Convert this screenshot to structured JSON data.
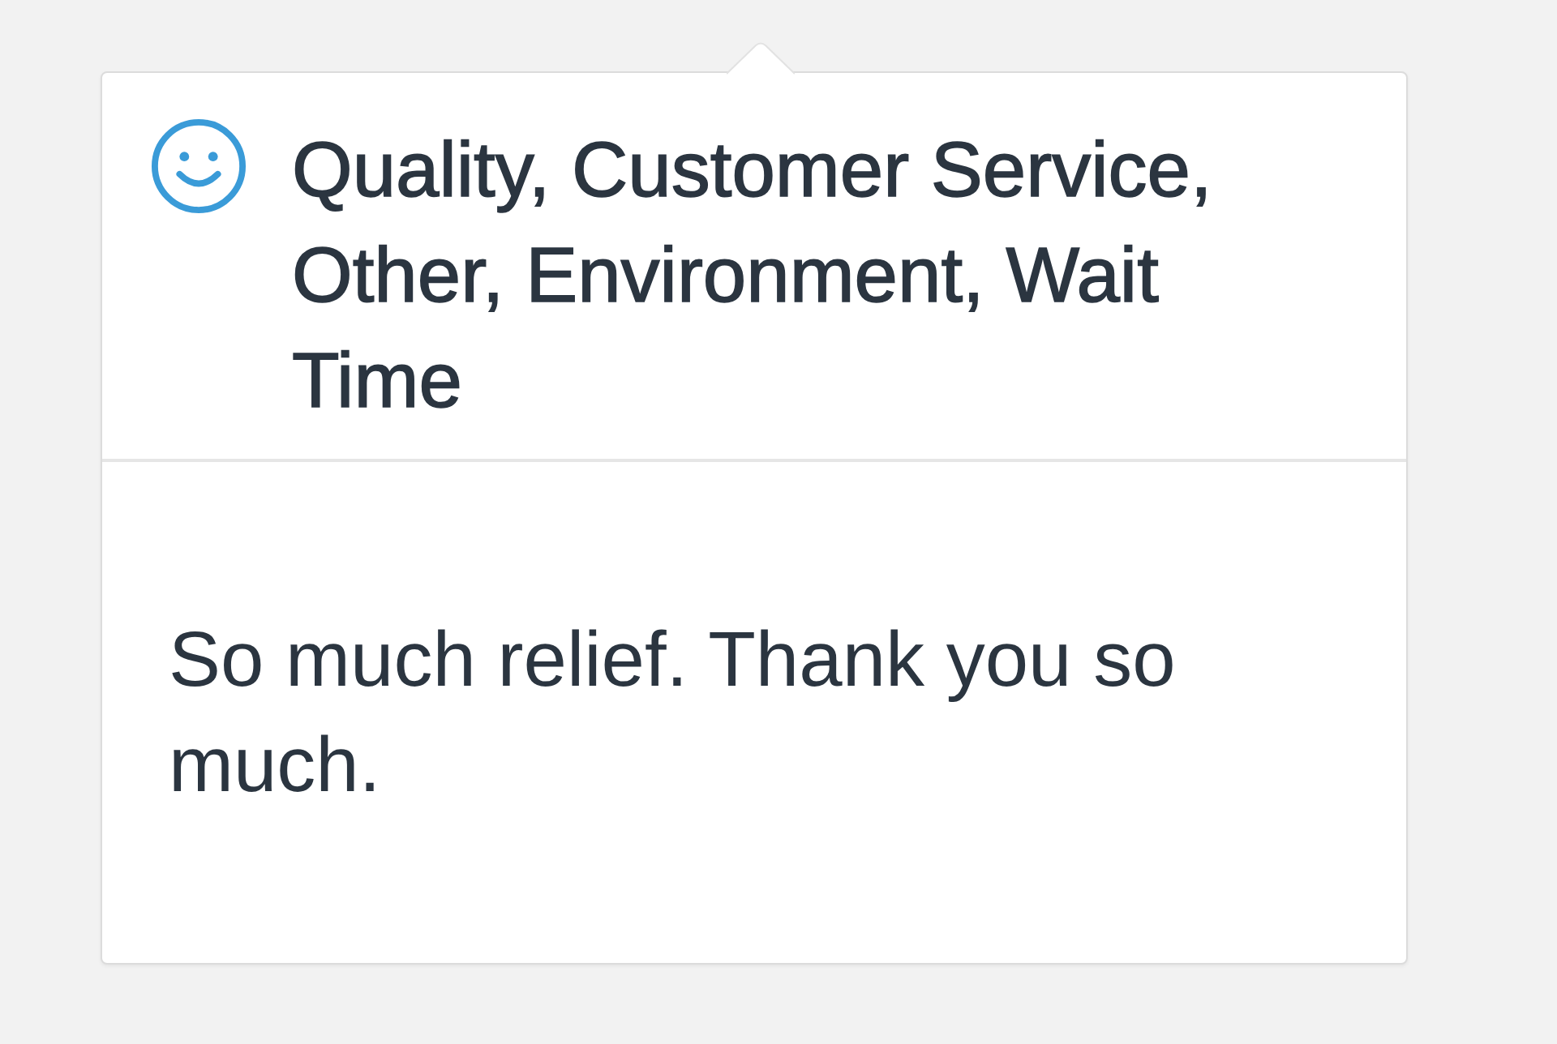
{
  "review": {
    "categories": "Quality, Customer Service, Other, Environment, Wait Time",
    "comment": "So much relief. Thank you so much."
  }
}
